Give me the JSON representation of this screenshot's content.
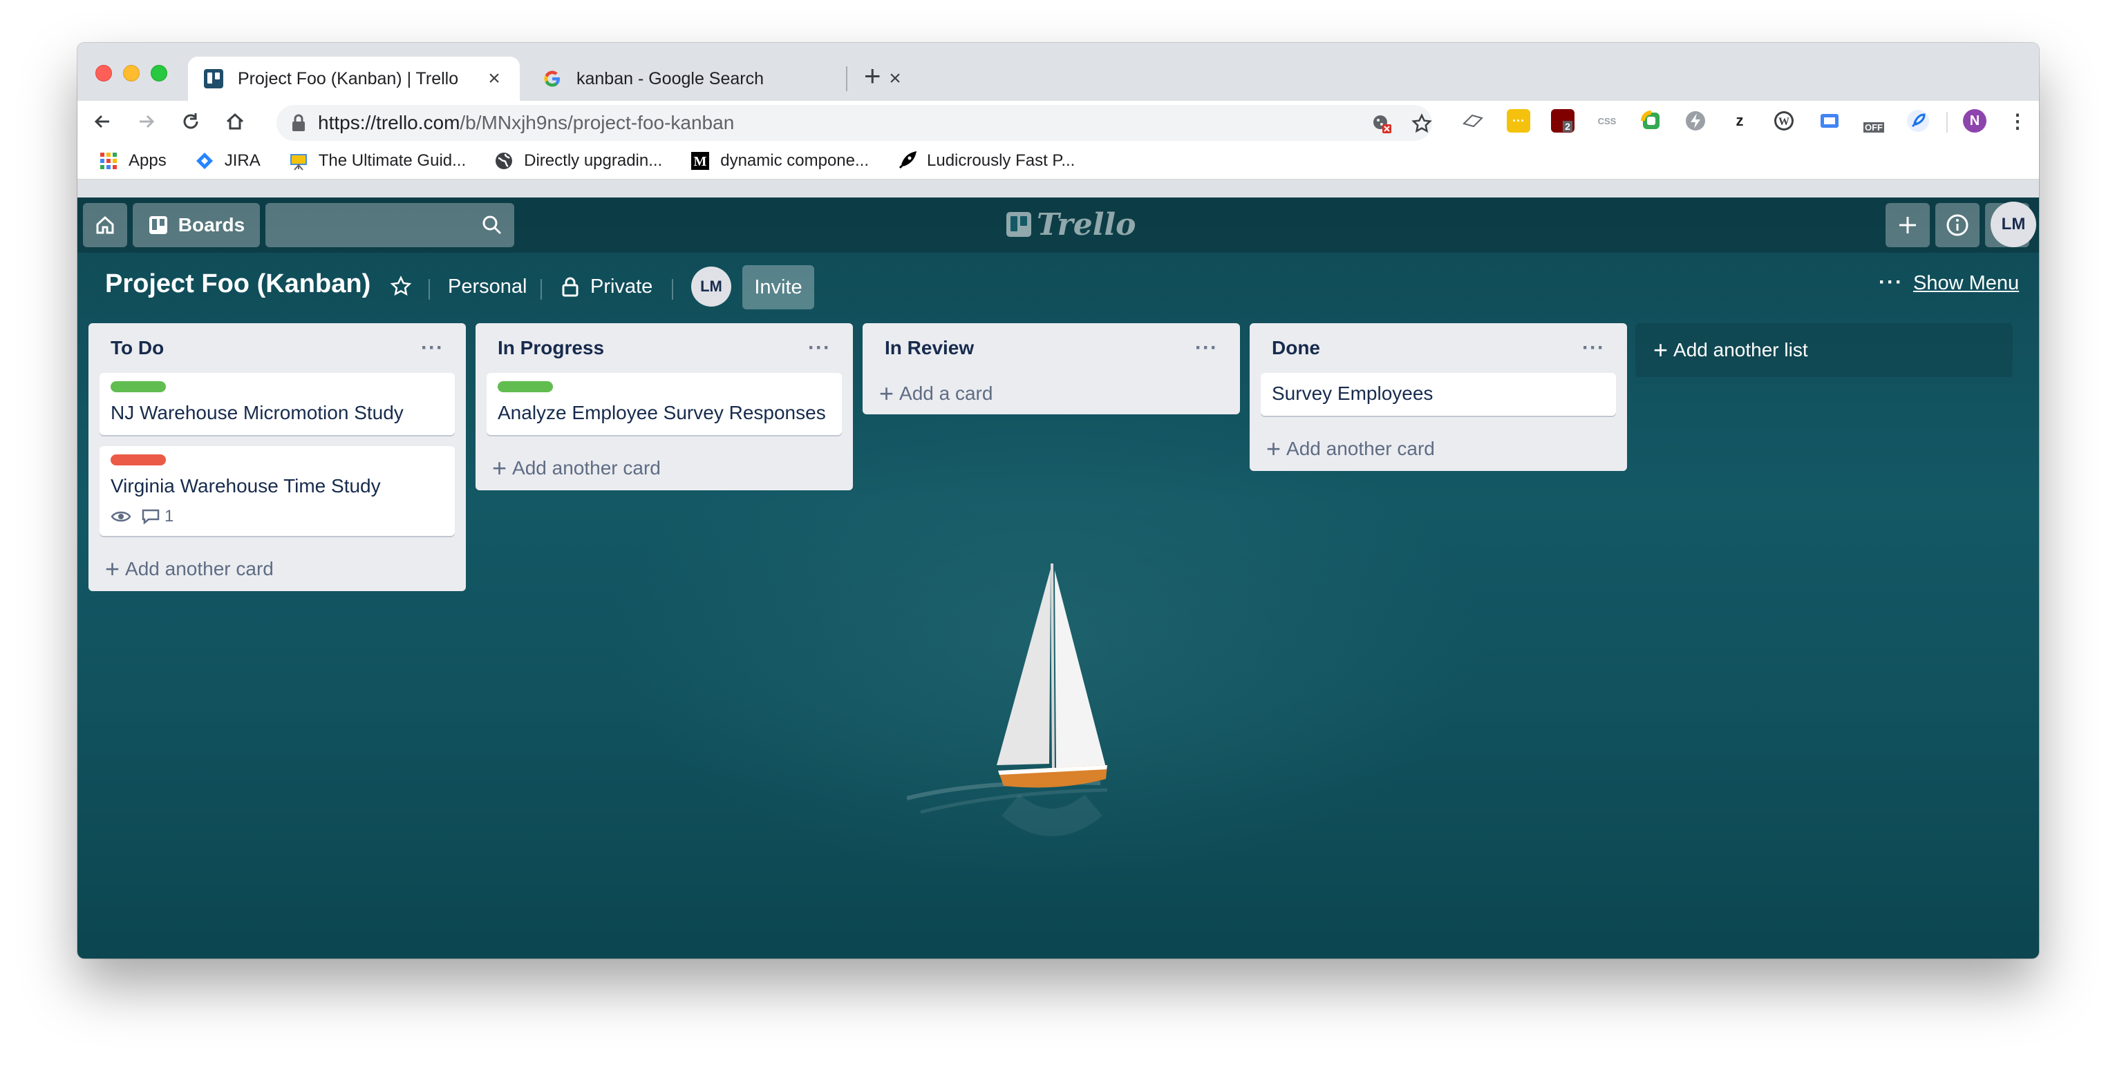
{
  "browser": {
    "tabs": [
      {
        "title": "Project Foo (Kanban) | Trello",
        "active": true,
        "favicon": "trello-icon"
      },
      {
        "title": "kanban - Google Search",
        "active": false,
        "favicon": "google-icon"
      }
    ],
    "url_host": "https://trello.com",
    "url_path": "/b/MNxjh9ns/project-foo-kanban",
    "profile_initial": "N",
    "extension_badges": {
      "ublock_count": "2",
      "off_label": "OFF"
    },
    "bookmarks": [
      {
        "label": "Apps",
        "icon": "apps-grid-icon"
      },
      {
        "label": "JIRA",
        "icon": "jira-icon"
      },
      {
        "label": "The Ultimate Guid...",
        "icon": "presentation-icon"
      },
      {
        "label": "Directly upgradin...",
        "icon": "globe-icon"
      },
      {
        "label": "dynamic compone...",
        "icon": "medium-icon"
      },
      {
        "label": "Ludicrously Fast P...",
        "icon": "rocket-icon"
      }
    ]
  },
  "trello": {
    "header": {
      "boards_label": "Boards",
      "logo_text": "Trello",
      "avatar_initials": "LM"
    },
    "board": {
      "title": "Project Foo (Kanban)",
      "team": "Personal",
      "visibility": "Private",
      "member_initials": "LM",
      "invite_label": "Invite",
      "show_menu_label": "Show Menu"
    },
    "lists": [
      {
        "title": "To Do",
        "cards": [
          {
            "title": "NJ Warehouse Micromotion Study",
            "label_color": "#61bd4f"
          },
          {
            "title": "Virginia Warehouse Time Study",
            "label_color": "#eb5a46",
            "comment_count": "1"
          }
        ],
        "add_label": "Add another card"
      },
      {
        "title": "In Progress",
        "cards": [
          {
            "title": "Analyze Employee Survey Responses",
            "label_color": "#61bd4f"
          }
        ],
        "add_label": "Add another card"
      },
      {
        "title": "In Review",
        "cards": [],
        "add_label": "Add a card"
      },
      {
        "title": "Done",
        "cards": [
          {
            "title": "Survey Employees"
          }
        ],
        "add_label": "Add another card"
      }
    ],
    "add_list_label": "Add another list"
  },
  "colors": {
    "green_label": "#61bd4f",
    "red_label": "#eb5a46",
    "board_background": "#145865"
  }
}
